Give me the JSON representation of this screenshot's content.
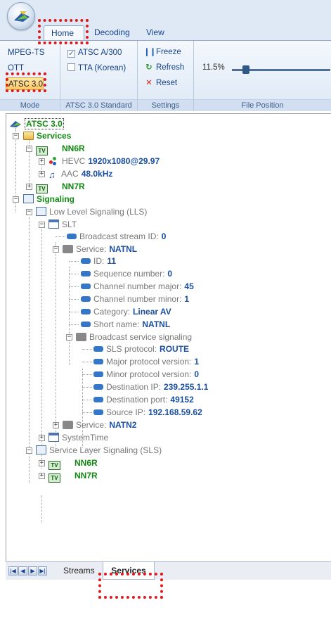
{
  "ribbon": {
    "tabs": [
      "Home",
      "Decoding",
      "View"
    ],
    "groups": {
      "mode": {
        "label": "Mode",
        "buttons": [
          "MPEG-TS",
          "OTT",
          "ATSC 3.0"
        ]
      },
      "standard": {
        "label": "ATSC 3.0 Standard",
        "options": [
          {
            "label": "ATSC A/300",
            "checked": true
          },
          {
            "label": "TTA (Korean)",
            "checked": false
          }
        ]
      },
      "settings": {
        "label": "Settings",
        "buttons": [
          "Freeze",
          "Refresh",
          "Reset"
        ]
      },
      "file_position": {
        "label": "File Position",
        "value": "11.5%",
        "fraction": 0.115
      }
    }
  },
  "tree": {
    "root": "ATSC 3.0",
    "services_label": "Services",
    "nn6r": "NN6R",
    "hevc_label": "HEVC",
    "hevc_value": "1920x1080@29.97",
    "aac_label": "AAC",
    "aac_value": "48.0kHz",
    "nn7r": "NN7R",
    "signaling_label": "Signaling",
    "lls_label": "Low Level Signaling (LLS)",
    "slt_label": "SLT",
    "bsid_label": "Broadcast stream ID:",
    "bsid_value": "0",
    "service1_label": "Service:",
    "service1_value": "NATNL",
    "fields": [
      {
        "label": "ID:",
        "value": "11"
      },
      {
        "label": "Sequence number:",
        "value": "0"
      },
      {
        "label": "Channel number major:",
        "value": "45"
      },
      {
        "label": "Channel number minor:",
        "value": "1"
      },
      {
        "label": "Category:",
        "value": "Linear AV"
      },
      {
        "label": "Short name:",
        "value": "NATNL"
      }
    ],
    "bss_label": "Broadcast service signaling",
    "bss_fields": [
      {
        "label": "SLS protocol:",
        "value": "ROUTE"
      },
      {
        "label": "Major protocol version:",
        "value": "1"
      },
      {
        "label": "Minor protocol version:",
        "value": "0"
      },
      {
        "label": "Destination IP:",
        "value": "239.255.1.1"
      },
      {
        "label": "Destination port:",
        "value": "49152"
      },
      {
        "label": "Source IP:",
        "value": "192.168.59.62"
      }
    ],
    "service2_label": "Service:",
    "service2_value": "NATN2",
    "systemtime_label": "SystemTime",
    "sls_label": "Service Layer Signaling (SLS)",
    "sls_nn6r": "NN6R",
    "sls_nn7r": "NN7R"
  },
  "bottom_tabs": {
    "streams": "Streams",
    "services": "Services"
  },
  "icons": {
    "tv": "TV",
    "nav_first": "first-page-icon",
    "nav_prev": "prev-page-icon",
    "nav_next": "next-page-icon",
    "nav_last": "last-page-icon"
  },
  "colors": {
    "highlight": "#e0181b",
    "node_green": "#108a10",
    "value_blue": "#1a4fa0",
    "active_mode": "#ffc965"
  }
}
